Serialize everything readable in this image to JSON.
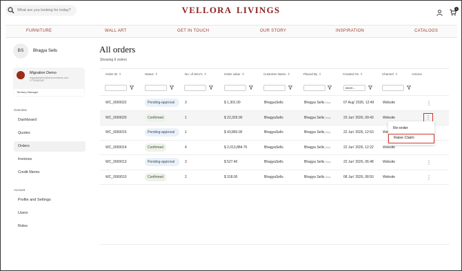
{
  "header": {
    "brand": "VELLORA  LIVINGS",
    "search_placeholder": "What are you looking for today?",
    "cart_count": "1"
  },
  "nav": [
    "FURNITURE",
    "WALL ART",
    "GET IN TOUCH",
    "OUR STORY",
    "INSPIRATION",
    "CATALOGS"
  ],
  "sidebar": {
    "avatar_initials": "BS",
    "user_name": "Bhagya Sells",
    "org": {
      "name": "Migration Demo",
      "email": "migrationdemo@vezcommerce.com",
      "phone": "17702587657",
      "role": "Territory Manager"
    },
    "overview_title": "Overview",
    "overview_items": [
      "Dashboard",
      "Quotes",
      "Orders",
      "Invoices",
      "Credit Memo"
    ],
    "account_title": "Account",
    "account_items": [
      "Profile and Settings",
      "Users",
      "Roles"
    ]
  },
  "main": {
    "title": "All orders",
    "showing": "Showing 6 orders",
    "columns": [
      "Order ID",
      "Status",
      "No. of SKU's",
      "Order value",
      "Customer Name",
      "Placed By",
      "Created On",
      "Channel",
      "Actions"
    ],
    "date_placeholder": "MM/D...",
    "rows": [
      {
        "order_id": "WC_0000022",
        "status": "Pending-approval",
        "status_type": "pending",
        "skus": "3",
        "value": "$ 1,301.00",
        "customer": "BhagyaSells",
        "placed_by": "Bhagya Sells",
        "you": "(You)",
        "created": "07 Aug' 2026, 12:49",
        "channel": "Website"
      },
      {
        "order_id": "WC_0000020",
        "status": "Confirmed",
        "status_type": "confirmed",
        "skus": "1",
        "value": "$ 22,329.00",
        "customer": "BhagyaSells",
        "placed_by": "Bhagya Sells",
        "you": "(You)",
        "created": "23 Jun' 2026, 09:43",
        "channel": "Website"
      },
      {
        "order_id": "WC_0000015",
        "status": "Pending-approval",
        "status_type": "pending",
        "skus": "1",
        "value": "$ 43,860.00",
        "customer": "BhagyaSells",
        "placed_by": "Bhagya Sells",
        "you": "(You)",
        "created": "22 Jun' 2026, 12:53",
        "channel": "Website"
      },
      {
        "order_id": "WC_0000014",
        "status": "Confirmed",
        "status_type": "confirmed",
        "skus": "4",
        "value": "$ 2,013,884.76",
        "customer": "BhagyaSells",
        "placed_by": "Bhagya Sells",
        "you": "(You)",
        "created": "22 Jun' 2026, 12:22",
        "channel": "Website"
      },
      {
        "order_id": "WC_0000013",
        "status": "Pending-approval",
        "status_type": "pending",
        "skus": "3",
        "value": "$ 527.40",
        "customer": "BhagyaSells",
        "placed_by": "Bhagya Sells",
        "you": "(You)",
        "created": "22 Jun' 2026, 06:48",
        "channel": "Website"
      },
      {
        "order_id": "WC_0000010",
        "status": "Confirmed",
        "status_type": "confirmed",
        "skus": "2",
        "value": "$ 318.00",
        "customer": "BhagyaSells",
        "placed_by": "Bhagya Sells",
        "you": "(You)",
        "created": "08 Jun' 2026, 08:50",
        "channel": "Website"
      }
    ],
    "action_menu": [
      "Re-order",
      "Raise Claim"
    ]
  },
  "colors": {
    "brand": "#8b2323",
    "nav_text": "#9a3b2a",
    "highlight_border": "#d0332b"
  }
}
